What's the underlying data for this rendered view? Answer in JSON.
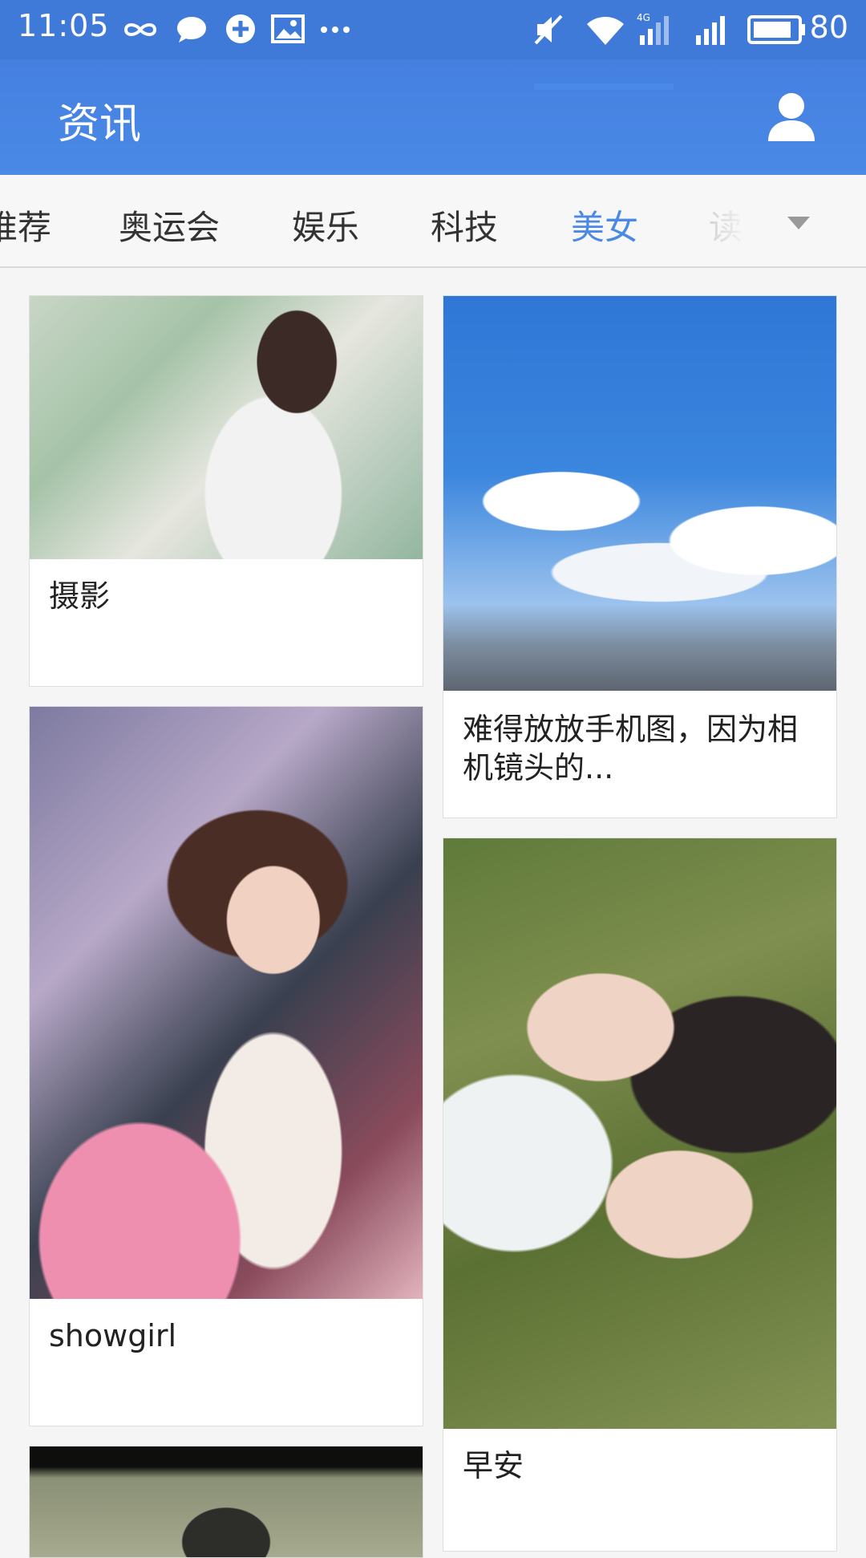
{
  "status_bar": {
    "time": "11:05",
    "battery_level": "80",
    "network_type": "4G",
    "icons": [
      "infinity-icon",
      "chat-bubble-icon",
      "sync-app-icon",
      "image-icon",
      "more-dots-icon",
      "mute-icon",
      "wifi-icon",
      "signal-4g-icon",
      "signal-icon",
      "battery-icon"
    ]
  },
  "app_bar": {
    "title": "资讯",
    "profile_icon": "person-icon"
  },
  "tabs": {
    "items": [
      {
        "label": "推荐",
        "active": false
      },
      {
        "label": "奥运会",
        "active": false
      },
      {
        "label": "娱乐",
        "active": false
      },
      {
        "label": "科技",
        "active": false
      },
      {
        "label": "美女",
        "active": true
      },
      {
        "label": "读",
        "active": false
      }
    ],
    "dropdown_icon": "chevron-down-icon"
  },
  "feed": {
    "cards": [
      {
        "caption": "摄影",
        "image": "photo-girl-drinking-water"
      },
      {
        "caption": "难得放放手机图，因为相机镜头的...",
        "image": "photo-figurines-sky-city"
      },
      {
        "caption": "showgirl",
        "image": "photo-girl-pink-backpack"
      },
      {
        "caption": "早安",
        "image": "photo-two-women-on-grass"
      },
      {
        "caption": "",
        "image": "photo-dark-partial"
      }
    ]
  },
  "colors": {
    "primary": "#4a89e6",
    "status_bar": "#3f7ad9",
    "background": "#f5f5f5"
  }
}
